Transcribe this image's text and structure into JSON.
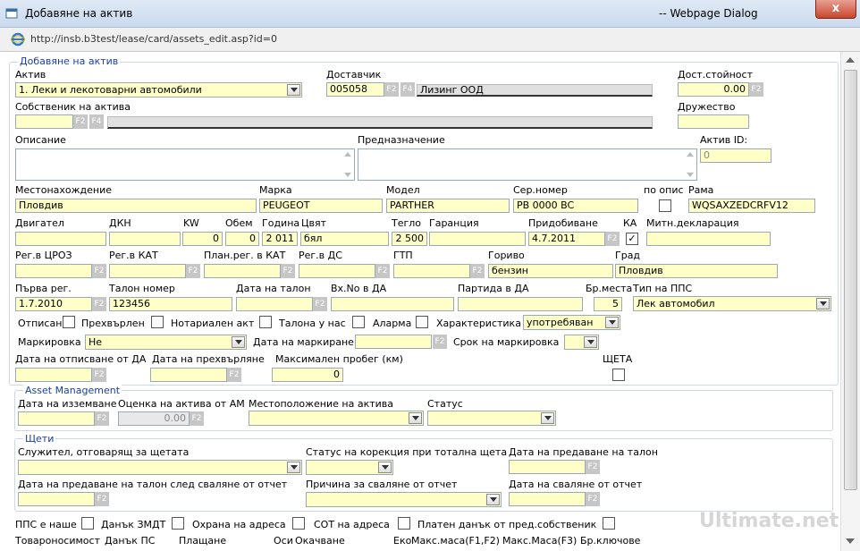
{
  "window": {
    "title": "Добавяне на актив",
    "right_title": "-- Webpage Dialog",
    "close": "x"
  },
  "address": {
    "url": "http://insb.b3test/lease/card/assets_edit.asp?id=0"
  },
  "section_main": {
    "legend": "Добавяне на актив"
  },
  "fkeys": {
    "f2": "F2",
    "f4": "F4"
  },
  "fields": {
    "aktiv": {
      "label": "Актив",
      "value": "1. Леки и лекотоварни автомобили"
    },
    "dostavchik": {
      "label": "Доставчик",
      "code": "005058",
      "name": "Лизинг ООД"
    },
    "dost_stoinost": {
      "label": "Дост.стойност",
      "value": "0.00"
    },
    "sobstvenik": {
      "label": "Собственик на актива",
      "value": ""
    },
    "druzhestvo": {
      "label": "Дружество",
      "value": ""
    },
    "opisanie": {
      "label": "Описание"
    },
    "prednaznachenie": {
      "label": "Предназначение"
    },
    "aktiv_id": {
      "label": "Актив ID:",
      "value": "0"
    },
    "mestonahozhdenie": {
      "label": "Местонахождение",
      "value": "Пловдив"
    },
    "marka": {
      "label": "Марка",
      "value": "PEUGEOT"
    },
    "model": {
      "label": "Модел",
      "value": "PARTHER"
    },
    "ser_nomer": {
      "label": "Сер.номер",
      "value": "PB 0000 BC"
    },
    "po_opis": {
      "label": "по опис"
    },
    "rama": {
      "label": "Рама",
      "value": "WQSAXZEDCRFV12"
    },
    "dvigatel": {
      "label": "Двигател",
      "value": ""
    },
    "dkn": {
      "label": "ДКН",
      "value": ""
    },
    "kw": {
      "label": "KW",
      "value": "0"
    },
    "obem": {
      "label": "Обем",
      "value": "0"
    },
    "godina": {
      "label": "Година",
      "value": "2 011"
    },
    "tsviat": {
      "label": "Цвят",
      "value": "бял"
    },
    "teglo": {
      "label": "Тегло",
      "value": "2 500"
    },
    "garantsia": {
      "label": "Гаранция",
      "value": ""
    },
    "pridobivane": {
      "label": "Придобиване",
      "value": "4.7.2011"
    },
    "ka": {
      "label": "КА",
      "checked": "✓"
    },
    "mitn_deklaratsia": {
      "label": "Митн.декларация",
      "value": ""
    },
    "reg_tsroz": {
      "label": "Рег.в ЦРОЗ"
    },
    "reg_kat": {
      "label": "Рег.в КАТ"
    },
    "plan_reg_kat": {
      "label": "План.рег. в КАТ"
    },
    "reg_ds": {
      "label": "Рег.в ДС"
    },
    "gtp": {
      "label": "ГТП"
    },
    "gorivo": {
      "label": "Гориво",
      "value": "бензин"
    },
    "grad": {
      "label": "Град",
      "value": "Пловдив"
    },
    "parva_reg": {
      "label": "Първа рег.",
      "value": "1.7.2010"
    },
    "talon_nomer": {
      "label": "Талон номер",
      "value": "123456"
    },
    "data_talon": {
      "label": "Дата на талон"
    },
    "vh_no_da": {
      "label": "Вх.No в ДА"
    },
    "partida_da": {
      "label": "Партида в ДА"
    },
    "br_mesta": {
      "label": "Бр.места",
      "value": "5"
    },
    "tip_pps": {
      "label": "Тип на ППС",
      "value": "Лек автомобил"
    },
    "otpisan": {
      "label": "Отписан"
    },
    "prehvarlen": {
      "label": "Прехвърлен"
    },
    "notarialen_akt": {
      "label": "Нотариален акт"
    },
    "talona_u_nas": {
      "label": "Талона у нас"
    },
    "alarma": {
      "label": "Аларма"
    },
    "harakteristika": {
      "label": "Характеристика",
      "value": "употребяван"
    },
    "markirovka": {
      "label": "Маркировка",
      "value": "Не"
    },
    "data_markirane": {
      "label": "Дата на маркиране"
    },
    "srok_markirovka": {
      "label": "Срок на маркировка"
    },
    "data_otpisvane": {
      "label": "Дата на отписване от ДА"
    },
    "data_prehvarliane": {
      "label": "Дата на прехвърляне"
    },
    "max_probeg": {
      "label": "Максимален пробег (км)",
      "value": "0"
    },
    "shteta": {
      "label": "ЩЕТА"
    }
  },
  "asset_mgmt": {
    "legend": "Asset Management",
    "data_izzemvane": "Дата на изземване",
    "otsenka": "Оценка на актива от АМ",
    "otsenka_value": "0.00",
    "mestopolozhenie": "Местоположение на актива",
    "status": "Статус"
  },
  "shteti": {
    "legend": "Щети",
    "sluzhitel": "Служител, отговарящ за щетата",
    "status_korektsia": "Статус на корекция при тотална щета",
    "data_predavane_talon": "Дата на предаване на талон",
    "data_predavane_sled": "Дата на предаване на талон след сваляне от отчет",
    "prichina": "Причина за сваляне от отчет",
    "data_svaliane": "Дата на сваляне от отчет"
  },
  "bottom": {
    "pps_nashe": "ППС е наше",
    "danak_zmdt": "Данък ЗМДТ",
    "ohrana": "Охрана на адреса",
    "sot": "СОТ на адреса",
    "platen_danak": "Платен данък от пред.собственик",
    "tovaronosimost": "Товароносимост",
    "danak_ps": "Данък ПС",
    "plashtane": "Плащане",
    "osi": "Оси",
    "okachvane": "Окачване",
    "eko": "Еко",
    "maks_masa_f12": "Макс.маса(F1,F2)",
    "maks_masa_f3": "Макс.Маса(F3)",
    "br_kliuchove": "Бр.ключове"
  },
  "watermark": "Ultimate.net"
}
